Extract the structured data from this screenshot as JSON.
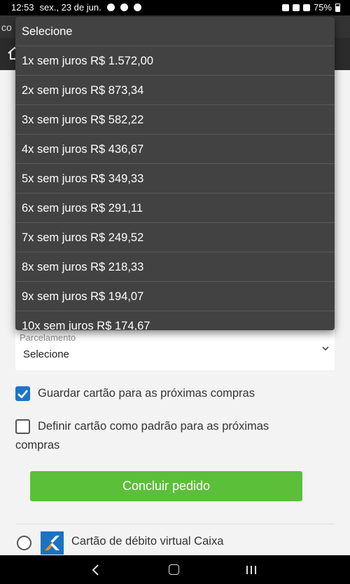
{
  "status_bar": {
    "time": "12:53",
    "date": "sex., 23 de jun.",
    "battery": "75%"
  },
  "browser": {
    "url_fragment": "co"
  },
  "installments_dropdown": {
    "header": "Selecione",
    "options": [
      "1x sem juros R$ 1.572,00",
      "2x sem juros R$ 873,34",
      "3x sem juros R$ 582,22",
      "4x sem juros R$ 436,67",
      "5x sem juros R$ 349,33",
      "6x sem juros R$ 291,11",
      "7x sem juros R$ 249,52",
      "8x sem juros R$ 218,33",
      "9x sem juros R$ 194,07",
      "10x sem juros R$ 174,67"
    ]
  },
  "form": {
    "installments_label": "Parcelamento",
    "installments_value": "Selecione",
    "save_card": {
      "label": "Guardar cartão para as próximas compras",
      "checked": true
    },
    "default_card": {
      "label_line1": "Definir cartão como padrão para as próximas",
      "label_line2": "compras",
      "checked": false
    },
    "submit_label": "Concluir pedido"
  },
  "payment_option": {
    "label": "Cartão de débito virtual Caixa",
    "selected": false
  },
  "colors": {
    "accent_blue": "#1e74c8",
    "submit_green": "#5bbf3a",
    "dropdown_bg": "#424242",
    "caixa_blue": "#1a73c2",
    "caixa_orange": "#f39200"
  }
}
